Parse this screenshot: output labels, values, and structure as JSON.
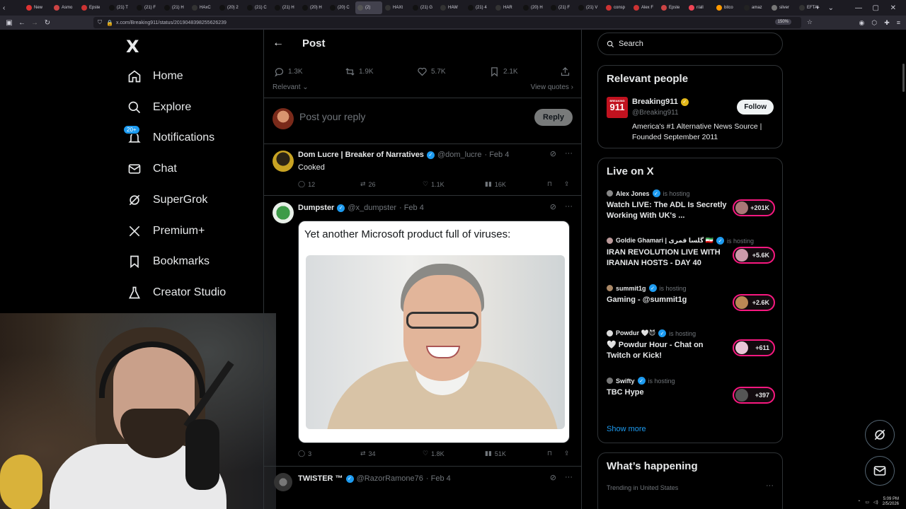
{
  "browser": {
    "tabs": [
      "New",
      "Asmo",
      "Epste",
      "(21) T",
      "(21) F",
      "(21) H",
      "HAxC",
      "(20) 2",
      "(21) C",
      "(21) H",
      "(20) H",
      "(20) C",
      "(2) ",
      "HAXt",
      "(21) G",
      "HAW",
      "(21) 4",
      "HAR",
      "(20) H",
      "(21) F",
      "(21) V",
      "consp",
      "Alex F",
      "Epste",
      "r/all",
      "bitco",
      "amaz",
      "silver",
      "EFTAI"
    ],
    "url": "x.com/Breaking911/status/2019048398255626239",
    "zoom": "150%"
  },
  "nav": {
    "logo": "X",
    "items": [
      {
        "label": "Home",
        "icon": "home-icon"
      },
      {
        "label": "Explore",
        "icon": "search-icon"
      },
      {
        "label": "Notifications",
        "icon": "bell-icon",
        "badge": "20+"
      },
      {
        "label": "Chat",
        "icon": "mail-icon"
      },
      {
        "label": "SuperGrok",
        "icon": "grok-icon"
      },
      {
        "label": "Premium+",
        "icon": "x-icon"
      },
      {
        "label": "Bookmarks",
        "icon": "bookmark-icon"
      },
      {
        "label": "Creator Studio",
        "icon": "flask-icon"
      }
    ]
  },
  "post": {
    "title": "Post",
    "stats": {
      "replies": "1.3K",
      "reposts": "1.9K",
      "likes": "5.7K",
      "bookmarks": "2.1K"
    },
    "sort": "Relevant",
    "view_quotes": "View quotes",
    "reply_placeholder": "Post your reply",
    "reply_button": "Reply"
  },
  "tweets": [
    {
      "name": "Dom Lucre | Breaker of Narratives",
      "handle": "@dom_lucre",
      "date": "· Feb 4",
      "text": "Cooked",
      "replies": "12",
      "reposts": "26",
      "likes": "1.1K",
      "views": "16K"
    },
    {
      "name": "Dumpster",
      "handle": "@x_dumpster",
      "date": "· Feb 4",
      "media_caption": "Yet another Microsoft product full of viruses:",
      "replies": "3",
      "reposts": "34",
      "likes": "1.8K",
      "views": "51K"
    },
    {
      "name": "TWISTER ™",
      "handle": "@RazorRamone76",
      "date": "· Feb 4"
    }
  ],
  "right": {
    "search_placeholder": "Search",
    "relevant_people": {
      "title": "Relevant people",
      "name": "Breaking911",
      "handle": "@Breaking911",
      "bio": "America's #1 Alternative News Source | Founded September 2011",
      "follow": "Follow",
      "logo_text": "911",
      "logo_top": "BREAKING"
    },
    "live": {
      "title": "Live on X",
      "hosting_label": "is hosting",
      "items": [
        {
          "host": "Alex Jones",
          "title": "Watch LIVE: The ADL Is Secretly Working With UK's ...",
          "count": "+201K"
        },
        {
          "host": "Goldie Ghamari | گلسا قمری 🇮🇷",
          "title": "IRAN REVOLUTION LIVE WITH IRANIAN HOSTS - DAY 40",
          "count": "+5.6K"
        },
        {
          "host": "summit1g",
          "title": "Gaming - @summit1g",
          "count": "+2.6K"
        },
        {
          "host": "Powdur 🤍😈",
          "title": "🤍 Powdur Hour - Chat on Twitch or  Kick!",
          "count": "+611"
        },
        {
          "host": "Swifty",
          "title": "TBC Hype",
          "count": "+397"
        }
      ],
      "show_more": "Show more"
    },
    "happening": {
      "title": "What’s happening",
      "trending": "Trending in United States"
    }
  },
  "taskbar": {
    "time": "5:09 PM",
    "date": "2/5/2026"
  },
  "colors": {
    "accent": "#1d9bf0",
    "live": "#f91880",
    "bg": "#000000",
    "border": "#2f3336"
  }
}
